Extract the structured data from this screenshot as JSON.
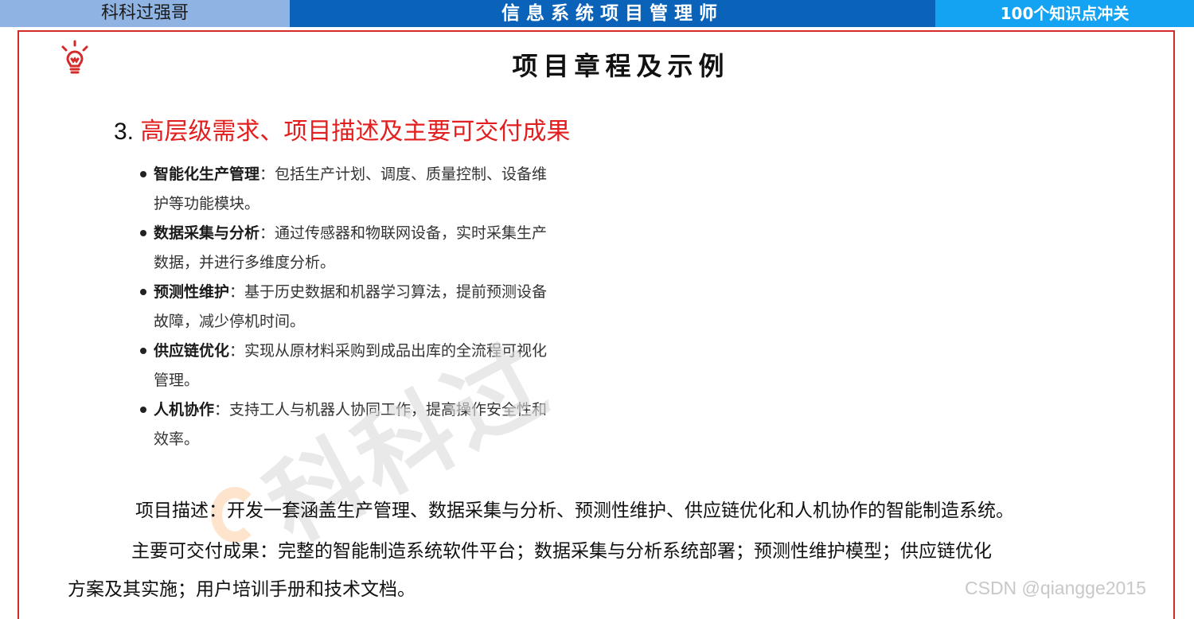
{
  "header": {
    "left_text": "科科过强哥",
    "center_title": "信息系统项目管理师",
    "right_text": "100个知识点冲关"
  },
  "page": {
    "title": "项目章程及示例",
    "icon": "lightbulb-icon",
    "accent_color": "#d42a2a"
  },
  "section": {
    "number": "3.",
    "heading": "高层级需求、项目描述及主要可交付成果",
    "heading_color": "#e31e1e"
  },
  "features": [
    {
      "term": "智能化生产管理",
      "desc": "：包括生产计划、调度、质量控制、设备维护等功能模块。"
    },
    {
      "term": "数据采集与分析",
      "desc": "：通过传感器和物联网设备，实时采集生产数据，并进行多维度分析。"
    },
    {
      "term": "预测性维护",
      "desc": "：基于历史数据和机器学习算法，提前预测设备故障，减少停机时间。"
    },
    {
      "term": "供应链优化",
      "desc": "：实现从原材料采购到成品出库的全流程可视化管理。"
    },
    {
      "term": "人机协作",
      "desc": "：支持工人与机器人协同工作，提高操作安全性和效率。"
    }
  ],
  "paragraphs": {
    "description": "项目描述：开发一套涵盖生产管理、数据采集与分析、预测性维护、供应链优化和人机协作的智能制造系统。",
    "deliverables_line1": "主要可交付成果：完整的智能制造系统软件平台；数据采集与分析系统部署；预测性维护模型；供应链优化",
    "deliverables_line2": "方案及其实施；用户培训手册和技术文档。"
  },
  "watermark": "科科过",
  "footer": {
    "csdn_watermark": "CSDN @qiangge2015"
  }
}
